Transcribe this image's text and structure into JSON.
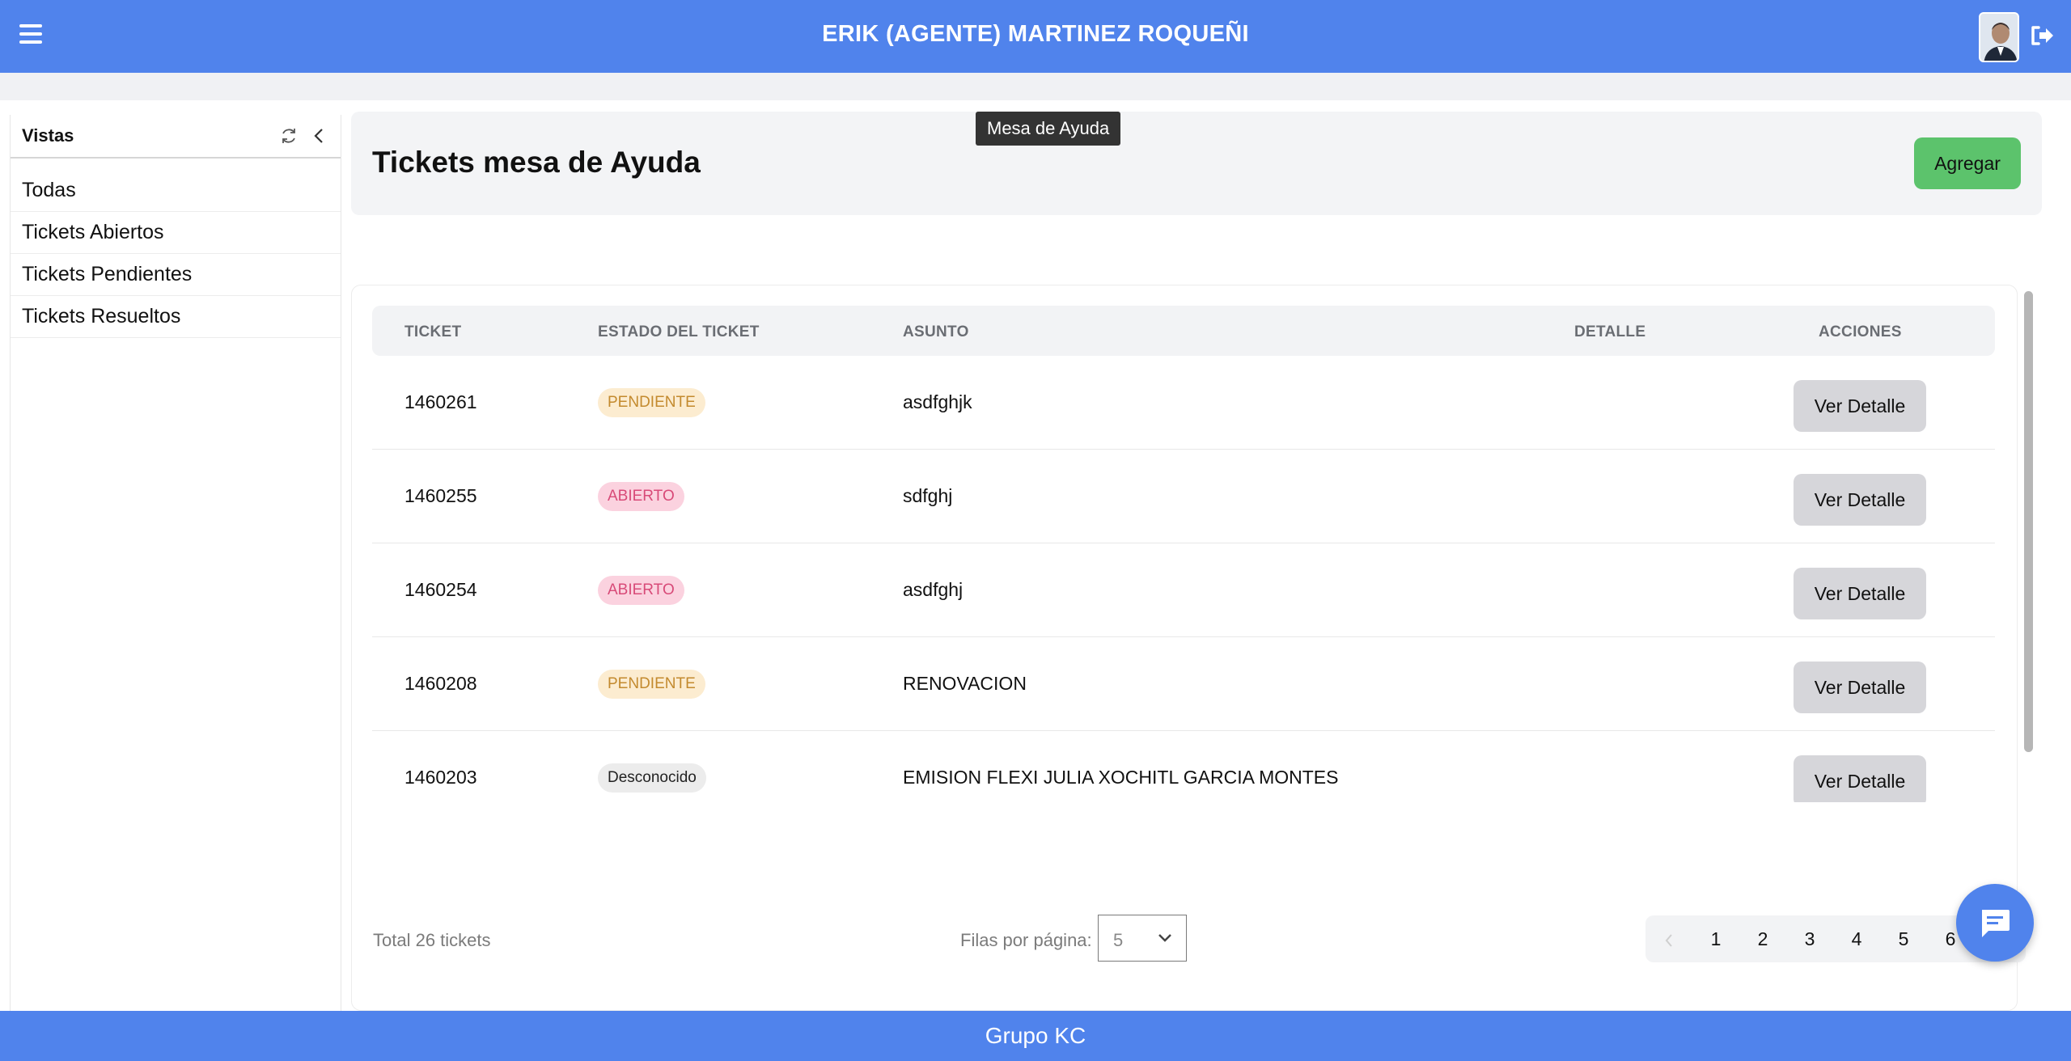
{
  "header": {
    "user_name": "ERIK (AGENTE) MARTINEZ ROQUEÑI"
  },
  "tooltip": "Mesa de Ayuda",
  "sidebar": {
    "title": "Vistas",
    "items": [
      {
        "label": "Todas"
      },
      {
        "label": "Tickets Abiertos"
      },
      {
        "label": "Tickets Pendientes"
      },
      {
        "label": "Tickets Resueltos"
      }
    ]
  },
  "page": {
    "title": "Tickets mesa de Ayuda",
    "add_label": "Agregar"
  },
  "table": {
    "columns": [
      "TICKET",
      "ESTADO DEL TICKET",
      "ASUNTO",
      "DETALLE",
      "ACCIONES"
    ],
    "action_label": "Ver Detalle",
    "rows": [
      {
        "ticket": "1460261",
        "estado": "PENDIENTE",
        "estado_type": "pendiente",
        "asunto": "asdfghjk"
      },
      {
        "ticket": "1460255",
        "estado": "ABIERTO",
        "estado_type": "abierto",
        "asunto": "sdfghj"
      },
      {
        "ticket": "1460254",
        "estado": "ABIERTO",
        "estado_type": "abierto",
        "asunto": "asdfghj"
      },
      {
        "ticket": "1460208",
        "estado": "PENDIENTE",
        "estado_type": "pendiente",
        "asunto": "RENOVACION"
      },
      {
        "ticket": "1460203",
        "estado": "Desconocido",
        "estado_type": "desconocido",
        "asunto": "EMISION FLEXI JULIA XOCHITL GARCIA MONTES"
      }
    ]
  },
  "pagination": {
    "total": "Total 26 tickets",
    "rows_label": "Filas por página:",
    "rows_value": "5",
    "pages": [
      "1",
      "2",
      "3",
      "4",
      "5",
      "6"
    ]
  },
  "footer": {
    "text": "Grupo KC"
  },
  "colors": {
    "brand_blue": "#5083ec",
    "add_green": "#5cc36c",
    "pendiente_bg": "#fcecd0",
    "abierto_bg": "#fbd2df"
  }
}
